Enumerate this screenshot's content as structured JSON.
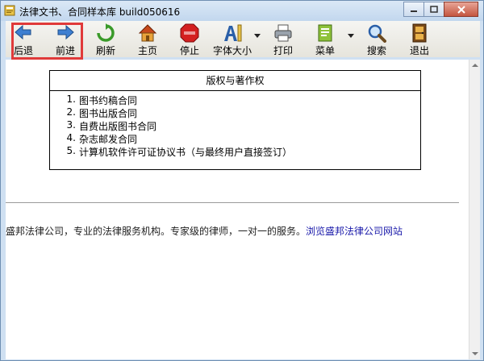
{
  "window": {
    "title": "法律文书、合同样本库 build050616"
  },
  "toolbar": {
    "buttons": [
      {
        "id": "back",
        "label": "后退",
        "icon": "back-arrow-icon"
      },
      {
        "id": "forward",
        "label": "前进",
        "icon": "forward-arrow-icon"
      },
      {
        "id": "refresh",
        "label": "刷新",
        "icon": "refresh-icon"
      },
      {
        "id": "home",
        "label": "主页",
        "icon": "home-icon"
      },
      {
        "id": "stop",
        "label": "停止",
        "icon": "stop-icon"
      },
      {
        "id": "fontsize",
        "label": "字体大小",
        "icon": "font-size-icon"
      },
      {
        "id": "print",
        "label": "打印",
        "icon": "printer-icon"
      },
      {
        "id": "menu",
        "label": "菜单",
        "icon": "menu-book-icon"
      },
      {
        "id": "search",
        "label": "搜索",
        "icon": "magnifier-icon"
      },
      {
        "id": "exit",
        "label": "退出",
        "icon": "exit-door-icon"
      }
    ]
  },
  "content": {
    "box_title": "版权与著作权",
    "items": [
      {
        "num": "1.",
        "text": "图书约稿合同"
      },
      {
        "num": "2.",
        "text": "图书出版合同"
      },
      {
        "num": "3.",
        "text": "自费出版图书合同"
      },
      {
        "num": "4.",
        "text": "杂志邮发合同"
      },
      {
        "num": "5.",
        "text": "计算机软件许可证协议书（与最终用户直接签订）"
      }
    ],
    "footer_text": "盛邦法律公司，专业的法律服务机构。专家级的律师，一对一的服务。",
    "footer_link": "浏览盛邦法律公司网站"
  },
  "colors": {
    "highlight": "#e03a3a",
    "link": "#1a1aaa",
    "frame": "#cfe0f2"
  }
}
